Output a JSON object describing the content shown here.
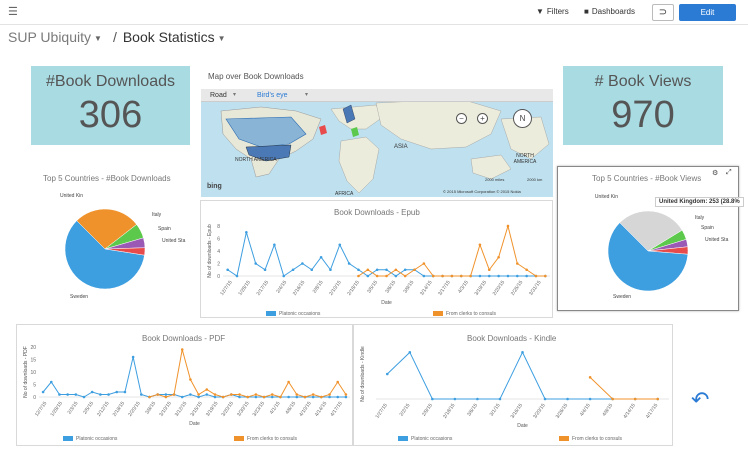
{
  "topbar": {
    "filters_label": "Filters",
    "dashboards_label": "Dashboards",
    "undo_glyph": "⊃",
    "edit_label": "Edit"
  },
  "breadcrumb": {
    "app": "SUP Ubiquity",
    "page": "Book Statistics",
    "separator": "/"
  },
  "kpis": {
    "downloads": {
      "label": "#Book Downloads",
      "value": "306"
    },
    "views": {
      "label": "# Book Views",
      "value": "970"
    }
  },
  "map": {
    "title": "Map over Book Downloads",
    "road_label": "Road",
    "birdseye_label": "Bird's eye",
    "labels": {
      "north_america": "NORTH AMERICA",
      "asia": "ASIA",
      "africa": "AFRICA",
      "north_america2": "NORTH AMERICA"
    },
    "scale_miles": "2000 miles",
    "scale_km": "2000 km",
    "copyright": "© 2015 Microsoft Corporation  © 2015 Nokia",
    "logo": "bing"
  },
  "icons": {
    "hamburger": "hamburger-icon",
    "filter": "filter-icon",
    "folder": "folder-icon",
    "undo": "undo-icon",
    "zoom_out": "zoom-out-icon",
    "zoom_in": "zoom-in-icon",
    "compass": "compass-icon",
    "big_undo": "undo-arrow-icon"
  },
  "colors": {
    "accent": "#2b7bd4",
    "kpi_bg": "#a9dbe3",
    "blue_series": "#3d9ee0",
    "orange_series": "#f0922b"
  },
  "legend": {
    "blue": "Platonic occasions",
    "orange": "From clerks to consuls"
  },
  "chart_data": [
    {
      "type": "pie",
      "title": "Top 5 Countries - #Book Downloads",
      "categories": [
        "United Kin",
        "Italy",
        "Spain",
        "United Sta",
        "Sweden"
      ],
      "values": [
        27,
        6,
        4,
        3,
        60
      ],
      "colors": [
        "#f0922b",
        "#5cc94c",
        "#9b59b6",
        "#e84b4b",
        "#3d9ee0"
      ]
    },
    {
      "type": "line",
      "title": "Book Downloads - Epub",
      "xlabel": "Date",
      "ylabel": "No of downloads - Epub",
      "ylim": [
        0,
        8
      ],
      "yticks": [
        0,
        2,
        4,
        6,
        8
      ],
      "xticks": [
        "12/7/15",
        "1/28/15",
        "2/17/15",
        "2/4/15",
        "2/16/15",
        "2/8/15",
        "2/10/15",
        "2/18/15",
        "3/5/15",
        "3/6/15",
        "3/9/15",
        "3/14/15",
        "3/17/15",
        "4/3/15",
        "3/19/15",
        "2/20/15",
        "2/25/15",
        "3/31/15"
      ],
      "series": [
        {
          "name": "Platonic occasions",
          "values": [
            1,
            0,
            7,
            2,
            1,
            5,
            0,
            1,
            2,
            1,
            3,
            1,
            5,
            2,
            1,
            0,
            1,
            1,
            0,
            1,
            1,
            0,
            0,
            0,
            0,
            0,
            0,
            0,
            0,
            0,
            0,
            0,
            0,
            0,
            0
          ]
        },
        {
          "name": "From clerks to consuls",
          "values": [
            null,
            null,
            null,
            null,
            null,
            null,
            null,
            null,
            null,
            null,
            null,
            null,
            null,
            null,
            0,
            1,
            0,
            0,
            1,
            0,
            1,
            2,
            0,
            0,
            0,
            0,
            0,
            5,
            1,
            3,
            8,
            2,
            1,
            0,
            0
          ]
        }
      ]
    },
    {
      "type": "pie",
      "title": "Top 5 Countries - #Book Views",
      "categories": [
        "United Kin",
        "Italy",
        "Spain",
        "United Sta",
        "Sweden"
      ],
      "values": [
        28.8,
        4,
        3,
        3,
        61.2
      ],
      "colors": [
        "#d6d6d6",
        "#5cc94c",
        "#9b59b6",
        "#e84b4b",
        "#3d9ee0"
      ],
      "tooltip": "United Kingdom: 253 (28.8%"
    },
    {
      "type": "line",
      "title": "Book Downloads - PDF",
      "xlabel": "Date",
      "ylabel": "No of downloads - PDF",
      "ylim": [
        0,
        20
      ],
      "yticks": [
        0,
        5,
        10,
        15,
        20
      ],
      "xticks": [
        "12/7/15",
        "1/28/15",
        "2/3/15",
        "2/5/15",
        "2/12/15",
        "2/18/15",
        "2/20/15",
        "3/8/15",
        "3/10/15",
        "3/12/15",
        "3/15/15",
        "3/19/15",
        "3/20/15",
        "3/30/15",
        "3/23/15",
        "4/1/15",
        "4/6/15",
        "4/10/15",
        "4/14/15",
        "4/17/15"
      ],
      "series": [
        {
          "name": "Platonic occasions",
          "values": [
            2,
            6,
            1,
            1,
            1,
            0,
            2,
            1,
            1,
            2,
            2,
            16,
            1,
            0,
            1,
            1,
            1,
            0,
            1,
            0,
            1,
            0,
            0,
            1,
            0,
            0,
            0,
            0,
            0,
            0,
            0,
            0,
            0,
            0,
            0,
            0,
            0,
            0
          ]
        },
        {
          "name": "From clerks to consuls",
          "values": [
            null,
            null,
            null,
            null,
            null,
            null,
            null,
            null,
            null,
            null,
            null,
            null,
            null,
            0,
            1,
            0,
            1,
            19,
            7,
            1,
            3,
            1,
            0,
            1,
            1,
            0,
            1,
            0,
            1,
            0,
            6,
            1,
            0,
            1,
            0,
            1,
            6,
            1
          ]
        }
      ]
    },
    {
      "type": "line",
      "title": "Book Downloads - Kindle",
      "xlabel": "Date",
      "ylabel": "No of downloads - Kindle",
      "ylim": [
        0,
        3
      ],
      "xticks": [
        "1/27/15",
        "2/2/15",
        "2/9/15",
        "2/18/15",
        "3/6/15",
        "3/1/15",
        "3/16/15",
        "3/20/15",
        "3/26/15",
        "4/4/15",
        "4/8/15",
        "4/14/15",
        "4/17/15"
      ],
      "series": [
        {
          "name": "Platonic occasions",
          "values": [
            1.5,
            2.8,
            0,
            0,
            0,
            0,
            2.8,
            0,
            0,
            0,
            0,
            0,
            0
          ]
        },
        {
          "name": "From clerks to consuls",
          "values": [
            null,
            null,
            null,
            null,
            null,
            null,
            null,
            null,
            null,
            1.3,
            0,
            0,
            0
          ]
        }
      ]
    }
  ]
}
